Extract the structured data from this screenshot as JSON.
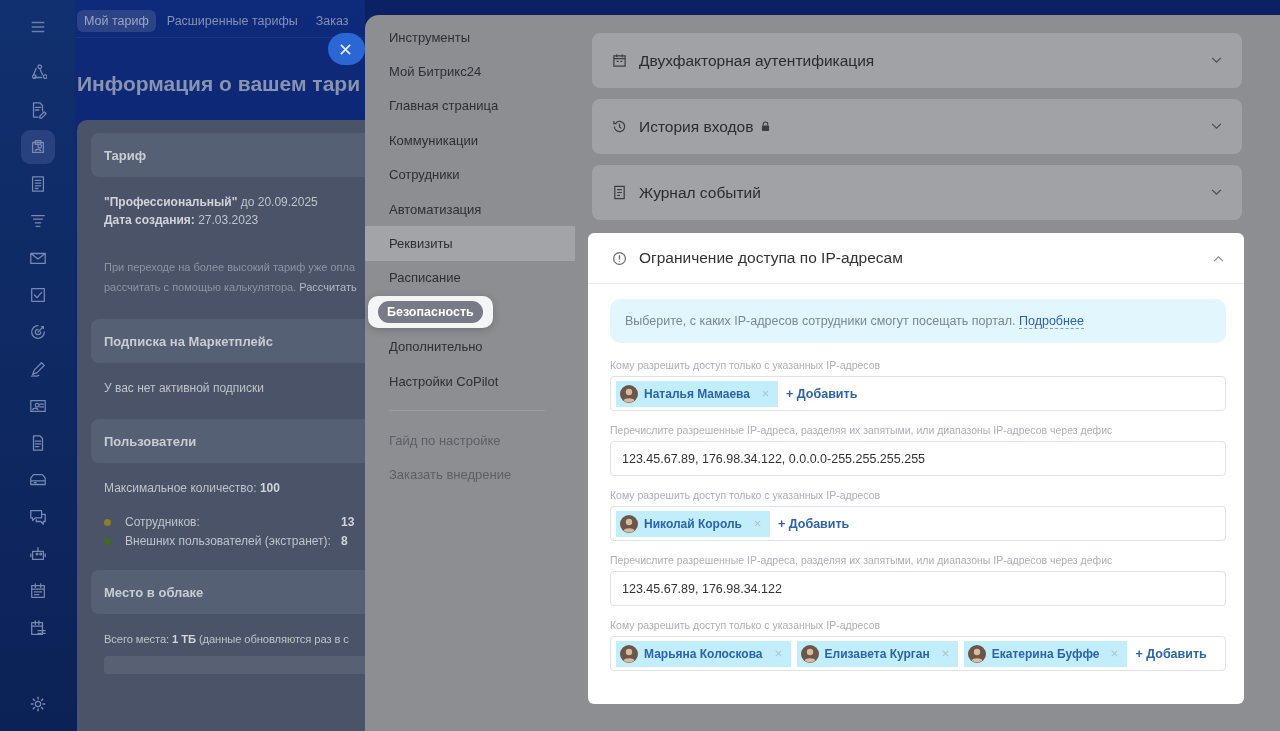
{
  "nav_rail": [
    {
      "selected": false
    },
    {
      "selected": false
    },
    {
      "selected": true
    },
    {
      "selected": false
    },
    {
      "selected": false
    },
    {
      "selected": false
    },
    {
      "selected": false
    },
    {
      "selected": false
    },
    {
      "selected": false
    },
    {
      "selected": false
    },
    {
      "selected": false
    },
    {
      "selected": false
    },
    {
      "selected": false
    },
    {
      "selected": false
    },
    {
      "selected": false
    },
    {
      "selected": false
    }
  ],
  "top_tabs": [
    {
      "label": "Мой тариф",
      "selected": true
    },
    {
      "label": "Расширенные тарифы",
      "selected": false
    },
    {
      "label": "Заказ",
      "selected": false
    }
  ],
  "page_title": "Информация о вашем тари",
  "plan_card": {
    "sections": [
      {
        "kind": "tariff",
        "title": "Тариф",
        "lines": [
          "**\"Профессиональный\"** до 20.09.2025",
          "**Дата создания:** 27.03.2023"
        ],
        "note_lines": [
          "При переходе на более высокий тариф уже опла",
          "рассчитать с помощью калькулятора."
        ],
        "note_link": "Рассчитать"
      },
      {
        "kind": "text",
        "title": "Подписка на Маркетплейс",
        "text": "У вас нет активной подписки"
      },
      {
        "kind": "users",
        "title": "Пользователи",
        "text": "Максимальное количество: **100**",
        "legend": [
          {
            "label": "Сотрудников:",
            "value": "13",
            "color": "#8c7d28"
          },
          {
            "label": "Внешних пользователей (экстранет):",
            "value": "8",
            "color": "#3f6b22"
          }
        ]
      },
      {
        "kind": "storage",
        "title": "Место в облаке",
        "text": "Всего места: **1 ТБ** (данные обновляются раз в с"
      }
    ]
  },
  "settings_menu": {
    "items": [
      {
        "label": "Инструменты",
        "selected": false,
        "hovered": false
      },
      {
        "label": "Мой Битрикс24",
        "selected": false,
        "hovered": false
      },
      {
        "label": "Главная страница",
        "selected": false,
        "hovered": false
      },
      {
        "label": "Коммуникации",
        "selected": false,
        "hovered": false
      },
      {
        "label": "Сотрудники",
        "selected": false,
        "hovered": false
      },
      {
        "label": "Автоматизация",
        "selected": false,
        "hovered": false
      },
      {
        "label": "Реквизиты",
        "selected": false,
        "hovered": true
      },
      {
        "label": "Расписание",
        "selected": false,
        "hovered": false
      },
      {
        "label": "Безопасность",
        "selected": true,
        "hovered": false
      },
      {
        "label": "Дополнительно",
        "selected": false,
        "hovered": false
      },
      {
        "label": "Настройки CoPilot",
        "selected": false,
        "hovered": false
      }
    ],
    "secondary": [
      "Гайд по настройке",
      "Заказать внедрение"
    ]
  },
  "sections": [
    {
      "title": "Двухфакторная аутентификация",
      "locked": false,
      "expanded": false
    },
    {
      "title": "История входов",
      "locked": true,
      "expanded": false
    },
    {
      "title": "Журнал событий",
      "locked": false,
      "expanded": false
    },
    {
      "title": "Ограничение доступа по IP-адресам",
      "locked": false,
      "expanded": true,
      "info": "Выберите, с каких IP-адресов сотрудники смогут посещать портал.",
      "info_link": "Подробнее",
      "fields": [
        {
          "kind": "users",
          "label": "Кому разрешить доступ только с указанных IP-адресов",
          "users": [
            "Наталья Мамаева"
          ],
          "add": "+ Добавить"
        },
        {
          "kind": "ips",
          "label": "Перечислите разрешенные IP-адреса, разделяя их запятыми, или диапазоны IP-адресов через дефис",
          "value": "123.45.67.89, 176.98.34.122, 0.0.0.0-255.255.255.255"
        },
        {
          "kind": "users",
          "label": "Кому разрешить доступ только с указанных IP-адресов",
          "users": [
            "Николай Король"
          ],
          "add": "+ Добавить"
        },
        {
          "kind": "ips",
          "label": "Перечислите разрешенные IP-адреса, разделяя их запятыми, или диапазоны IP-адресов через дефис",
          "value": "123.45.67.89, 176.98.34.122"
        },
        {
          "kind": "users",
          "label": "Кому разрешить доступ только с указанных IP-адресов",
          "users": [
            "Марьяна Колоскова",
            "Елизавета Курган",
            "Екатерина Буффе"
          ],
          "add": "+ Добавить"
        }
      ]
    }
  ]
}
